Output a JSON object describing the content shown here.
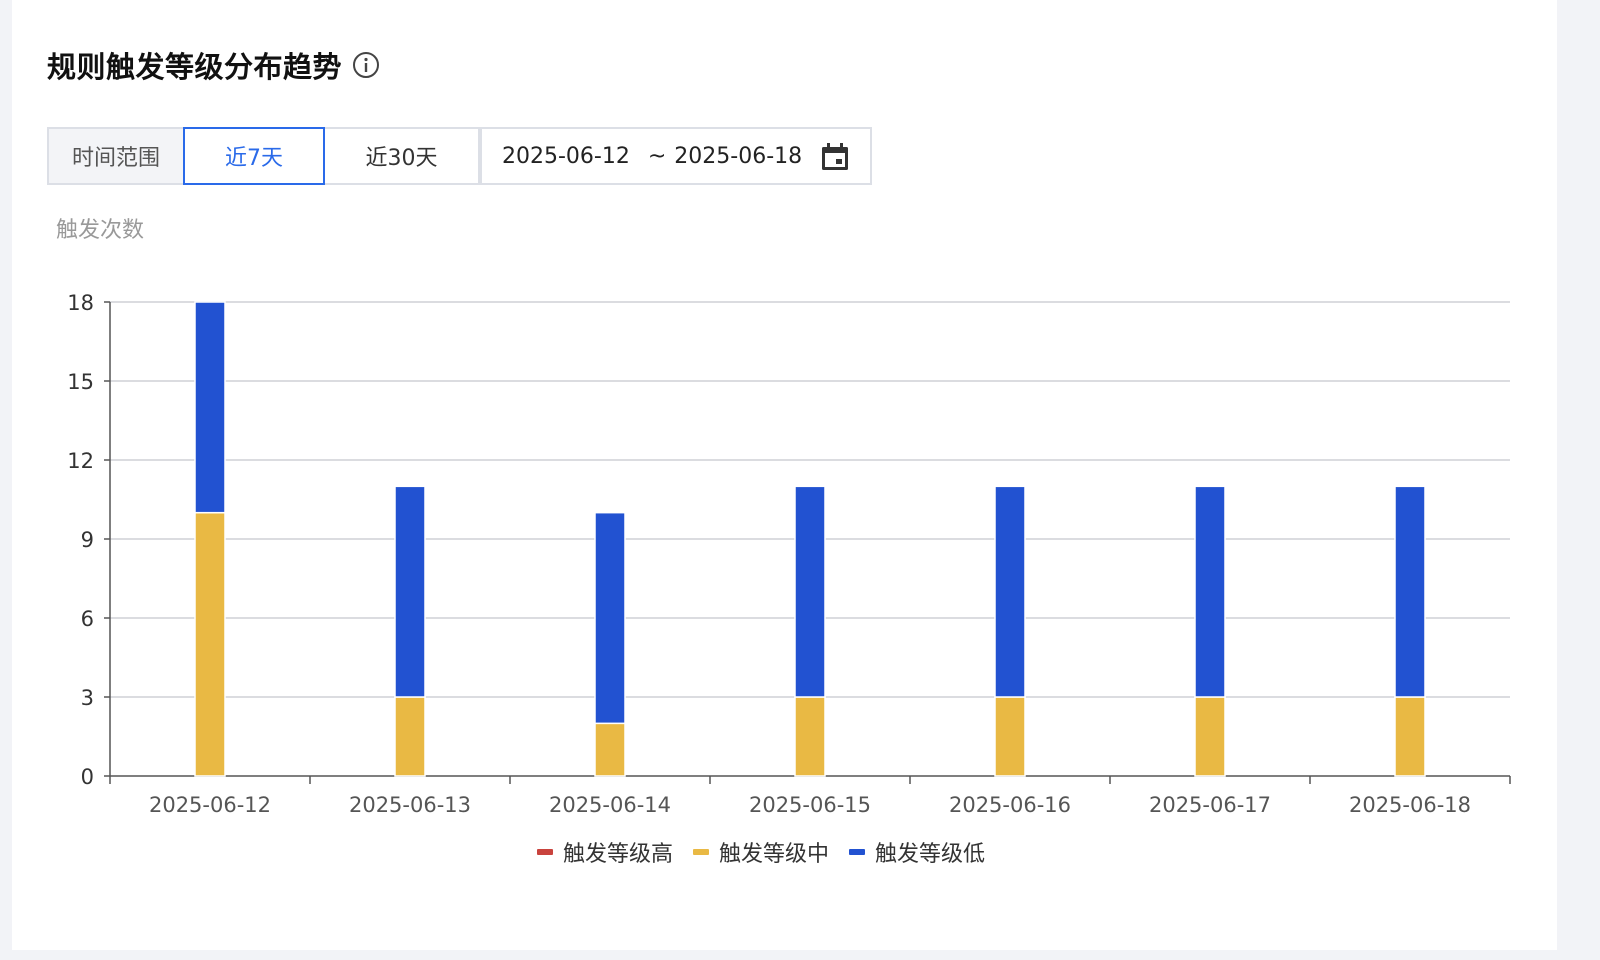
{
  "header": {
    "title": "规则触发等级分布趋势",
    "info_icon": "info-circle-icon"
  },
  "filter": {
    "label": "时间范围",
    "options": [
      "近7天",
      "近30天"
    ],
    "selected": "近7天",
    "date_start": "2025-06-12",
    "date_sep": "~",
    "date_end": "2025-06-18",
    "calendar_icon": "calendar-icon"
  },
  "colors": {
    "high": "#c9433d",
    "mid": "#e9b944",
    "low": "#2252d1",
    "accent": "#2a6ae9"
  },
  "chart_data": {
    "type": "bar",
    "stacked": true,
    "ylabel": "触发次数",
    "xlabel": "",
    "ylim": [
      0,
      18
    ],
    "yticks": [
      0,
      3,
      6,
      9,
      12,
      15,
      18
    ],
    "grid": true,
    "legend_position": "bottom",
    "categories": [
      "2025-06-12",
      "2025-06-13",
      "2025-06-14",
      "2025-06-15",
      "2025-06-16",
      "2025-06-17",
      "2025-06-18"
    ],
    "series": [
      {
        "name": "触发等级高",
        "color": "#c9433d",
        "values": [
          0,
          0,
          0,
          0,
          0,
          0,
          0
        ]
      },
      {
        "name": "触发等级中",
        "color": "#e9b944",
        "values": [
          10,
          3,
          2,
          3,
          3,
          3,
          3
        ]
      },
      {
        "name": "触发等级低",
        "color": "#2252d1",
        "values": [
          8,
          8,
          8,
          8,
          8,
          8,
          8
        ]
      }
    ]
  }
}
